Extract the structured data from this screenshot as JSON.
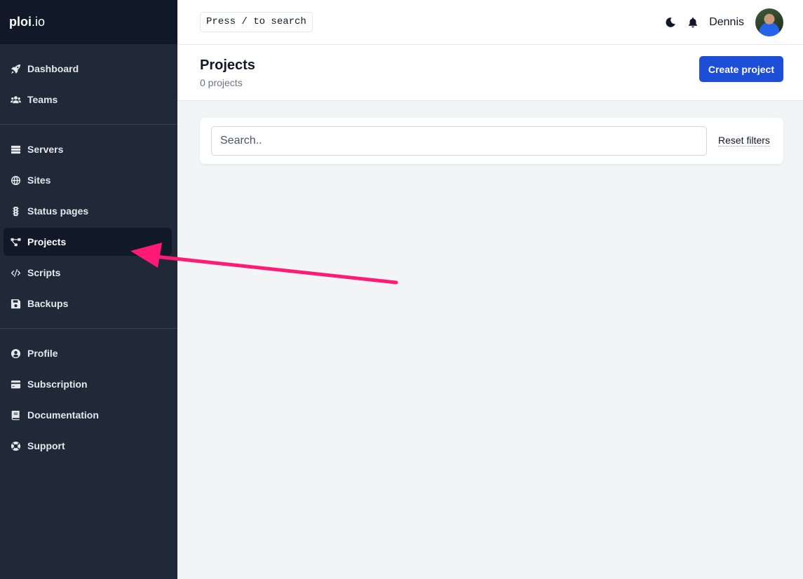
{
  "brand": {
    "bold": "ploi",
    "light": ".io"
  },
  "sidebar": {
    "groups": [
      [
        {
          "label": "Dashboard",
          "icon": "rocket-icon"
        },
        {
          "label": "Teams",
          "icon": "users-icon"
        }
      ],
      [
        {
          "label": "Servers",
          "icon": "server-icon"
        },
        {
          "label": "Sites",
          "icon": "globe-icon"
        },
        {
          "label": "Status pages",
          "icon": "traffic-light-icon"
        },
        {
          "label": "Projects",
          "icon": "project-diagram-icon",
          "active": true
        },
        {
          "label": "Scripts",
          "icon": "code-icon"
        },
        {
          "label": "Backups",
          "icon": "save-icon"
        }
      ],
      [
        {
          "label": "Profile",
          "icon": "user-circle-icon"
        },
        {
          "label": "Subscription",
          "icon": "credit-card-icon"
        },
        {
          "label": "Documentation",
          "icon": "book-icon"
        },
        {
          "label": "Support",
          "icon": "life-ring-icon"
        }
      ]
    ]
  },
  "topbar": {
    "search_hint": "Press / to search",
    "username": "Dennis"
  },
  "header": {
    "title": "Projects",
    "subtitle": "0 projects",
    "create_label": "Create project"
  },
  "filters": {
    "search_placeholder": "Search..",
    "reset_label": "Reset filters"
  },
  "colors": {
    "sidebar_bg": "#1f2937",
    "brand_bg": "#111827",
    "primary": "#1d4ed8",
    "annotation_arrow": "#ff1a75"
  }
}
